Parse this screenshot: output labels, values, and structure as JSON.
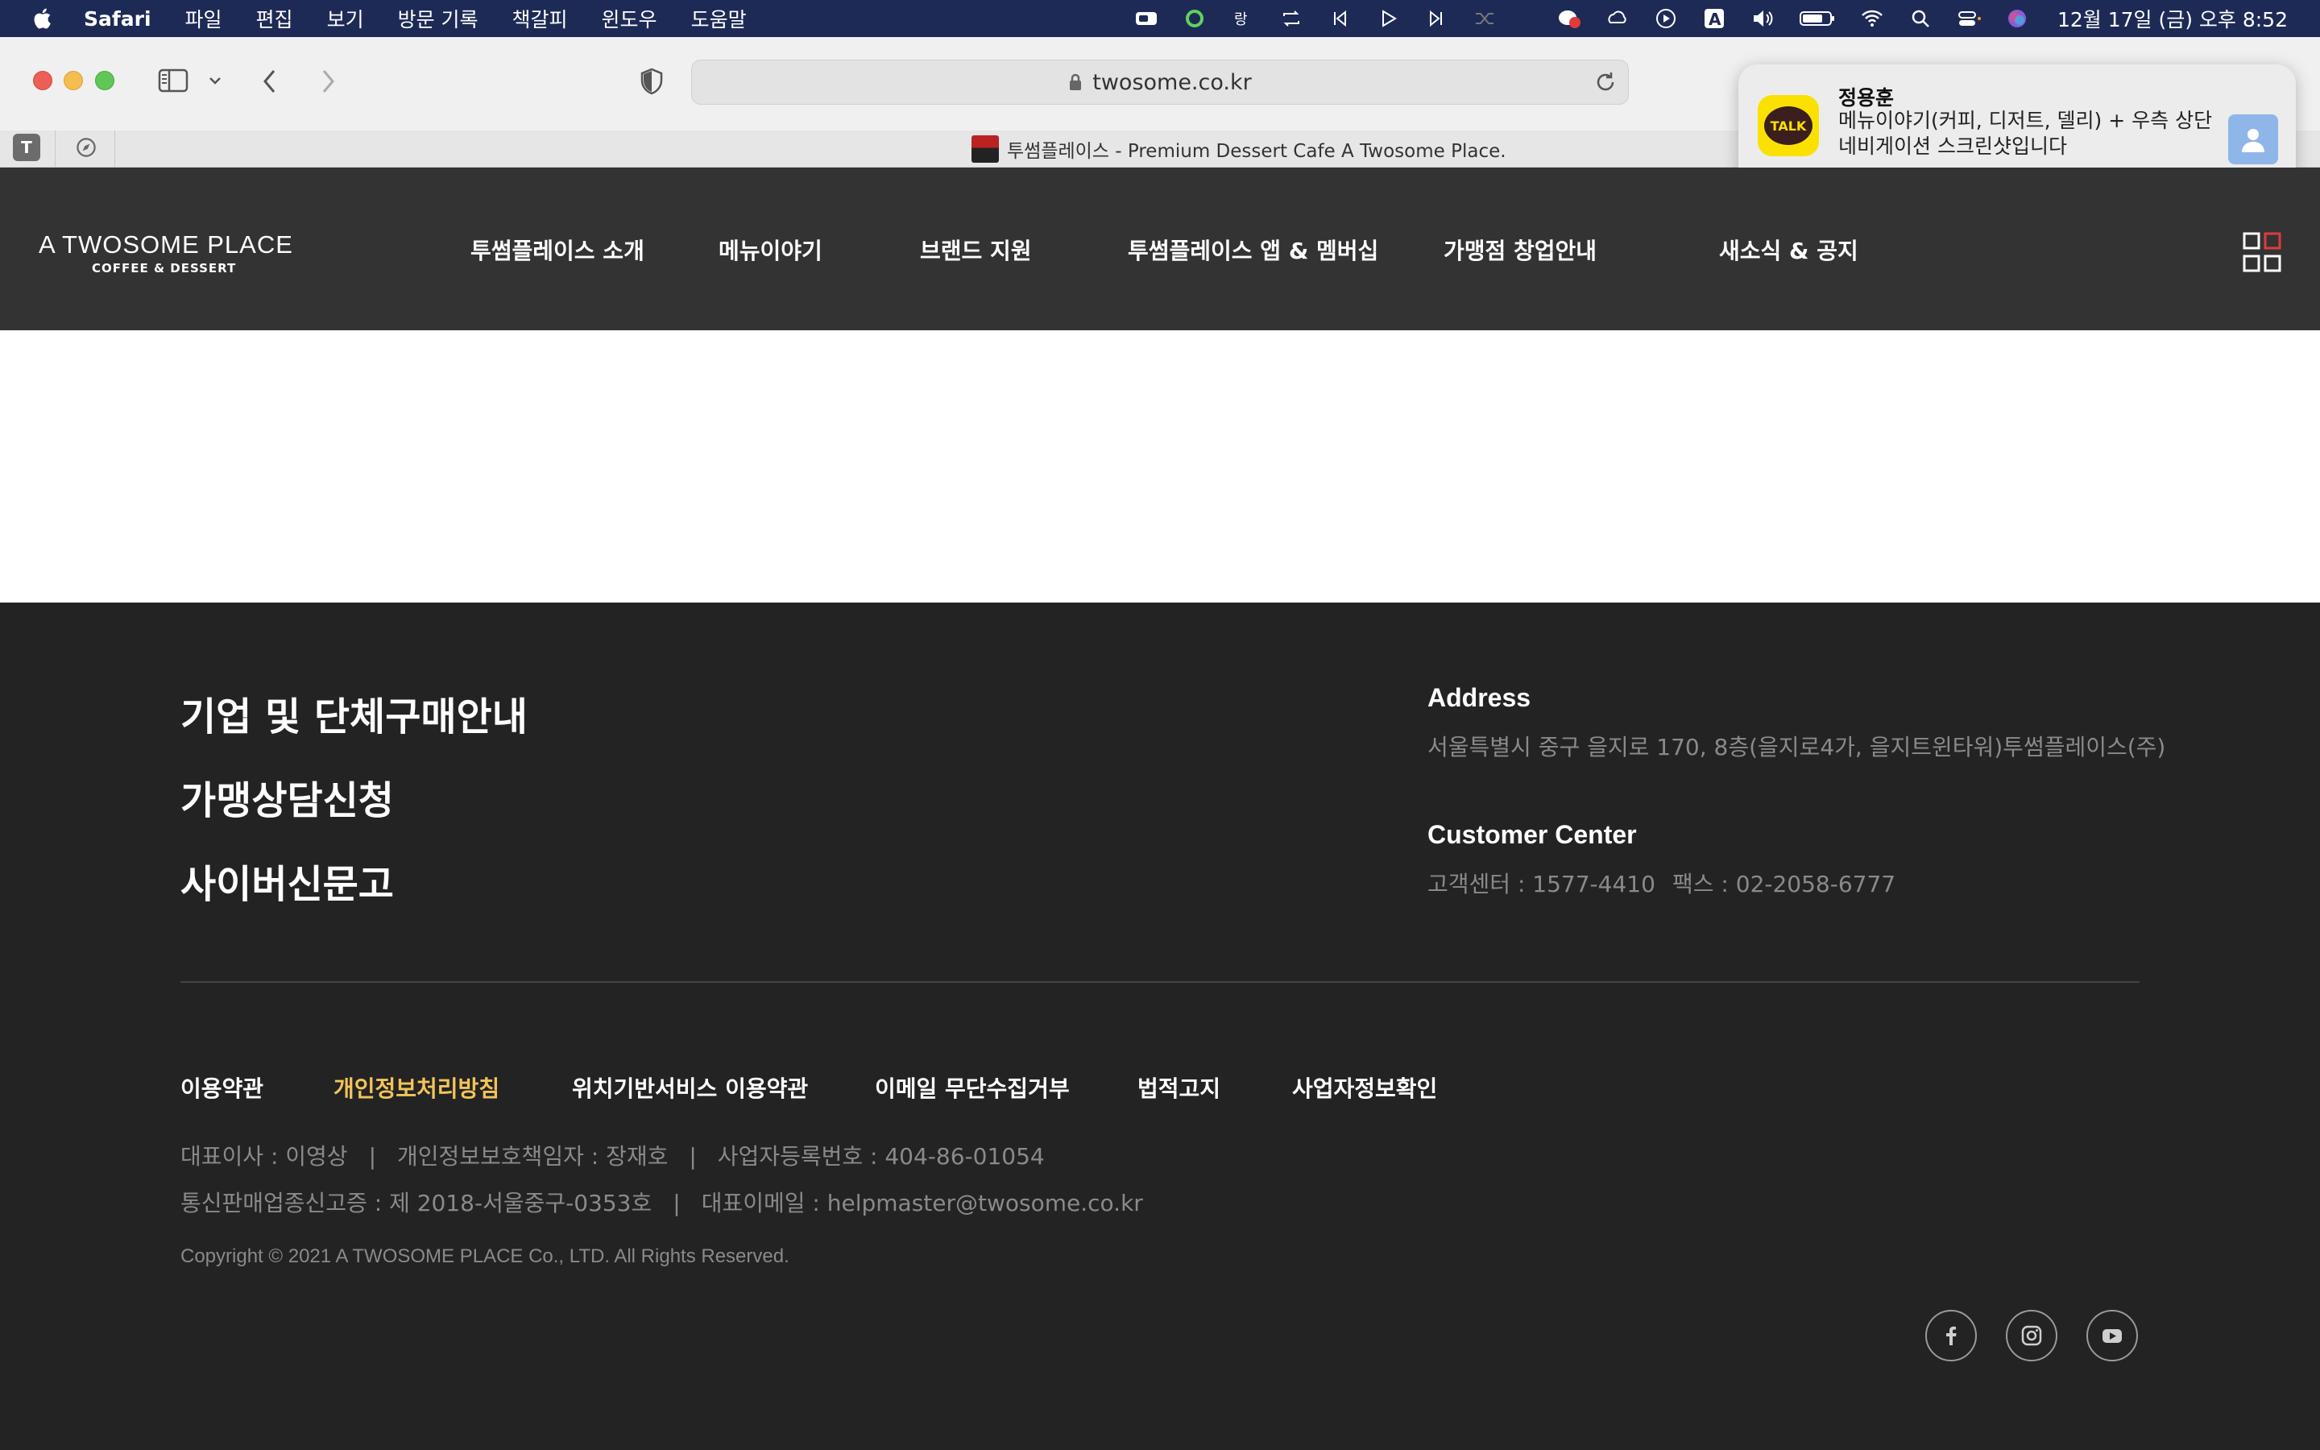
{
  "menubar": {
    "app_name": "Safari",
    "items": [
      "파일",
      "편집",
      "보기",
      "방문 기록",
      "책갈피",
      "윈도우",
      "도움말"
    ],
    "clock": "12월 17일 (금) 오후 8:52"
  },
  "browser": {
    "url": "twosome.co.kr",
    "tab_title": "투썸플레이스 - Premium Dessert Cafe A Twosome Place.",
    "pinned_tab_letter": "T"
  },
  "notification": {
    "app": "TALK",
    "sender": "정용훈",
    "message": "메뉴이야기(커피, 디저트, 델리) + 우측 상단 네비게이션 스크린샷입니다"
  },
  "site": {
    "logo_line1": "A TWOSOME PLACE",
    "logo_line2": "COFFEE & DESSERT",
    "nav": [
      "투썸플레이스 소개",
      "메뉴이야기",
      "브랜드 지원",
      "투썸플레이스 앱 & 멤버십",
      "가맹점 창업안내",
      "새소식 & 공지"
    ]
  },
  "footer": {
    "links": [
      "기업 및 단체구매안내",
      "가맹상담신청",
      "사이버신문고"
    ],
    "address_heading": "Address",
    "address": "서울특별시 중구 을지로 170, 8층(을지로4가, 을지트윈타워)투썸플레이스(주)",
    "cc_heading": "Customer Center",
    "cc_phone": "고객센터 : 1577-4410",
    "cc_fax": "팩스 : 02-2058-6777",
    "policies": [
      "이용약관",
      "개인정보처리방침",
      "위치기반서비스 이용약관",
      "이메일 무단수집거부",
      "법적고지",
      "사업자정보확인"
    ],
    "ceo": "대표이사 : 이영상",
    "privacy_officer": "개인정보보호책임자 : 장재호",
    "biz_reg": "사업자등록번호 : 404-86-01054",
    "mail_order": "통신판매업종신고증 : 제 2018-서울중구-0353호",
    "email": "대표이메일 : helpmaster@twosome.co.kr",
    "separator": "|",
    "copyright": "Copyright © 2021 A TWOSOME PLACE Co., LTD.  All Rights Reserved."
  },
  "colors": {
    "header_bg": "#333333",
    "footer_bg": "#232323",
    "highlight": "#f2c45a"
  },
  "icons": [
    "apple-icon",
    "sidebar-icon",
    "back-icon",
    "forward-icon",
    "shield-icon",
    "lock-icon",
    "reload-icon",
    "menu-grid-icon",
    "facebook-icon",
    "instagram-icon",
    "youtube-icon"
  ]
}
